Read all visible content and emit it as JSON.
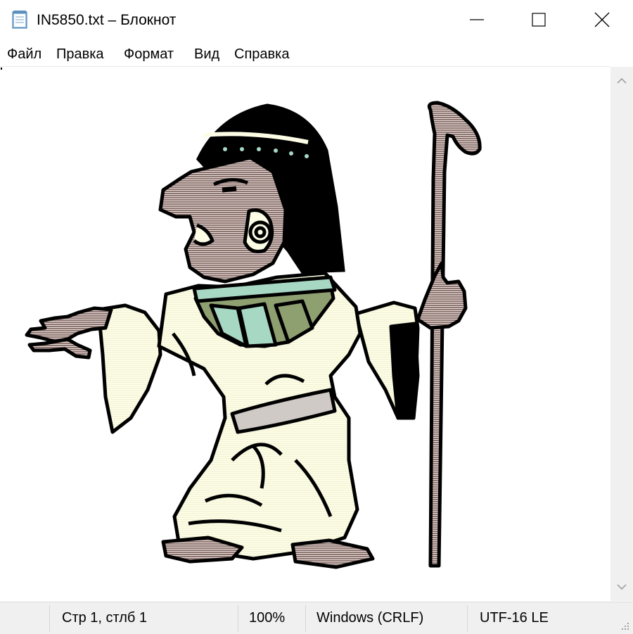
{
  "window": {
    "title": "IN5850.txt – Блокнот",
    "icon": "notepad-icon",
    "controls": [
      "minimize-icon",
      "maximize-icon",
      "close-icon"
    ]
  },
  "menu": {
    "items": [
      "Файл",
      "Правка",
      "Формат",
      "Вид",
      "Справка"
    ]
  },
  "editor": {
    "content_image": "ascii-art-egyptian-woman-with-staff"
  },
  "statusbar": {
    "position": "Стр 1, стлб 1",
    "zoom": "100%",
    "line_endings": "Windows (CRLF)",
    "encoding": "UTF-16 LE"
  },
  "colors": {
    "skin": "#8e7670",
    "hair": "#000000",
    "robe": "#fdfde6",
    "collar_green": "#8fa070",
    "collar_teal": "#a7d8c4",
    "statusbar_bg": "#f0f0f0"
  }
}
